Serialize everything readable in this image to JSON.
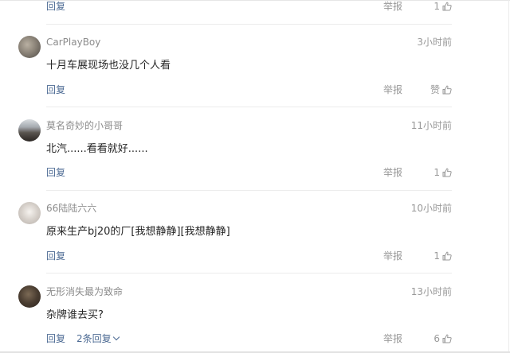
{
  "labels": {
    "reply": "回复",
    "report": "举报"
  },
  "top": {
    "likes": "1"
  },
  "comments": [
    {
      "author": "CarPlayBoy",
      "time": "3小时前",
      "text": "十月车展现场也没几个人看",
      "likes": "赞",
      "avatar_icon": "user-avatar-icon"
    },
    {
      "author": "莫名奇妙的小哥哥",
      "time": "11小时前",
      "text": "北汽......看看就好......",
      "likes": "1",
      "avatar_icon": "user-avatar-icon"
    },
    {
      "author": "66陆陆六六",
      "time": "10小时前",
      "text": "原来生产bj20的厂[我想静静][我想静静]",
      "likes": "1",
      "avatar_icon": "user-avatar-icon"
    },
    {
      "author": "无形消失最为致命",
      "time": "13小时前",
      "text": "杂牌谁去买?",
      "likes": "6",
      "more_replies": "2条回复",
      "avatar_icon": "user-avatar-icon"
    }
  ],
  "colors": {
    "link": "#4d6b94",
    "muted": "#999999",
    "text": "#262626",
    "divider": "#ececec"
  }
}
